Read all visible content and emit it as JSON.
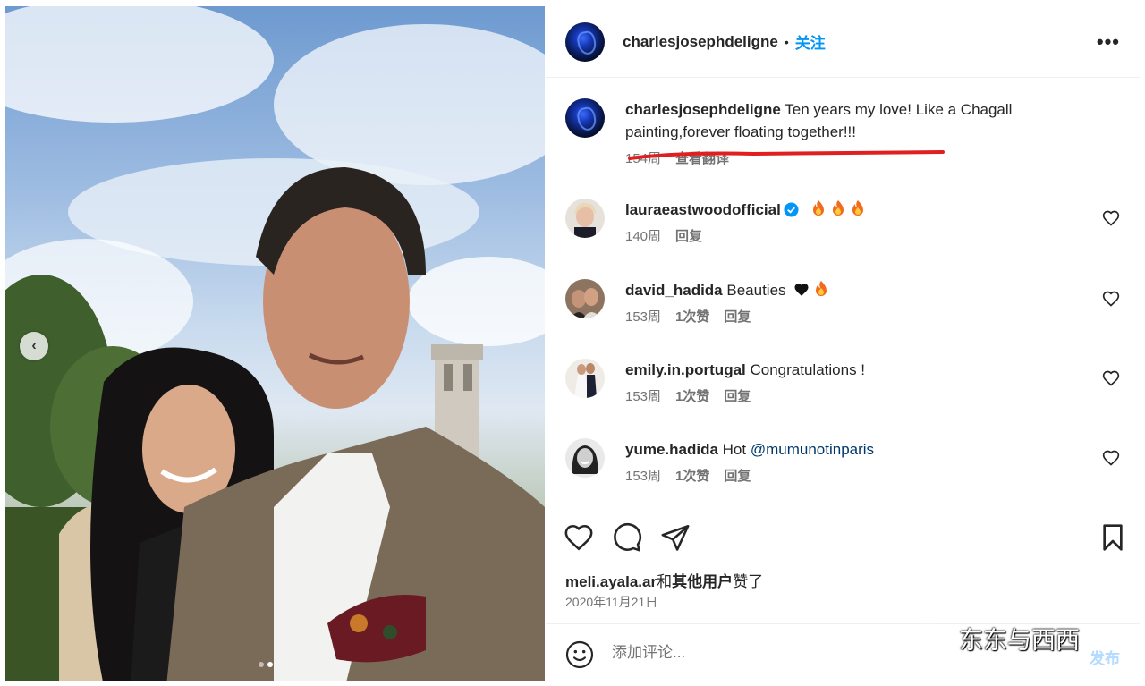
{
  "post": {
    "author": "charlesjosephdeligne",
    "follow_label": "关注",
    "more_label": "•••",
    "carousel": {
      "prev_label": "‹",
      "slide_count": 2,
      "active_index": 1
    }
  },
  "caption": {
    "user": "charlesjosephdeligne",
    "text": "Ten years my love! Like a Chagall painting,forever floating together!!!",
    "age": "154周",
    "translate_label": "查看翻译"
  },
  "comments": [
    {
      "user": "lauraeastwoodofficial",
      "verified": true,
      "text": "",
      "emoji": [
        "fire-emoji",
        "fire-emoji",
        "fire-emoji"
      ],
      "age": "140周",
      "likes": "",
      "reply_label": "回复"
    },
    {
      "user": "david_hadida",
      "verified": false,
      "text": "Beauties",
      "emoji": [
        "black-heart-emoji",
        "fire-emoji"
      ],
      "age": "153周",
      "likes": "1次赞",
      "reply_label": "回复"
    },
    {
      "user": "emily.in.portugal",
      "verified": false,
      "text": "Congratulations !",
      "emoji": [],
      "age": "153周",
      "likes": "1次赞",
      "reply_label": "回复"
    },
    {
      "user": "yume.hadida",
      "verified": false,
      "text": "Hot",
      "mention": "@mumunotinparis",
      "emoji": [],
      "age": "153周",
      "likes": "1次赞",
      "reply_label": "回复"
    }
  ],
  "likes_line": {
    "user": "meli.ayala.ar",
    "joiner": "和",
    "others": "其他用户",
    "suffix": "赞了"
  },
  "date": "2020年11月21日",
  "composer": {
    "placeholder": "添加评论...",
    "post_label": "发布"
  },
  "watermark": {
    "text": "东东与西西"
  },
  "colors": {
    "accent": "#0095f6",
    "underline": "#e02020",
    "muted": "#737373"
  }
}
